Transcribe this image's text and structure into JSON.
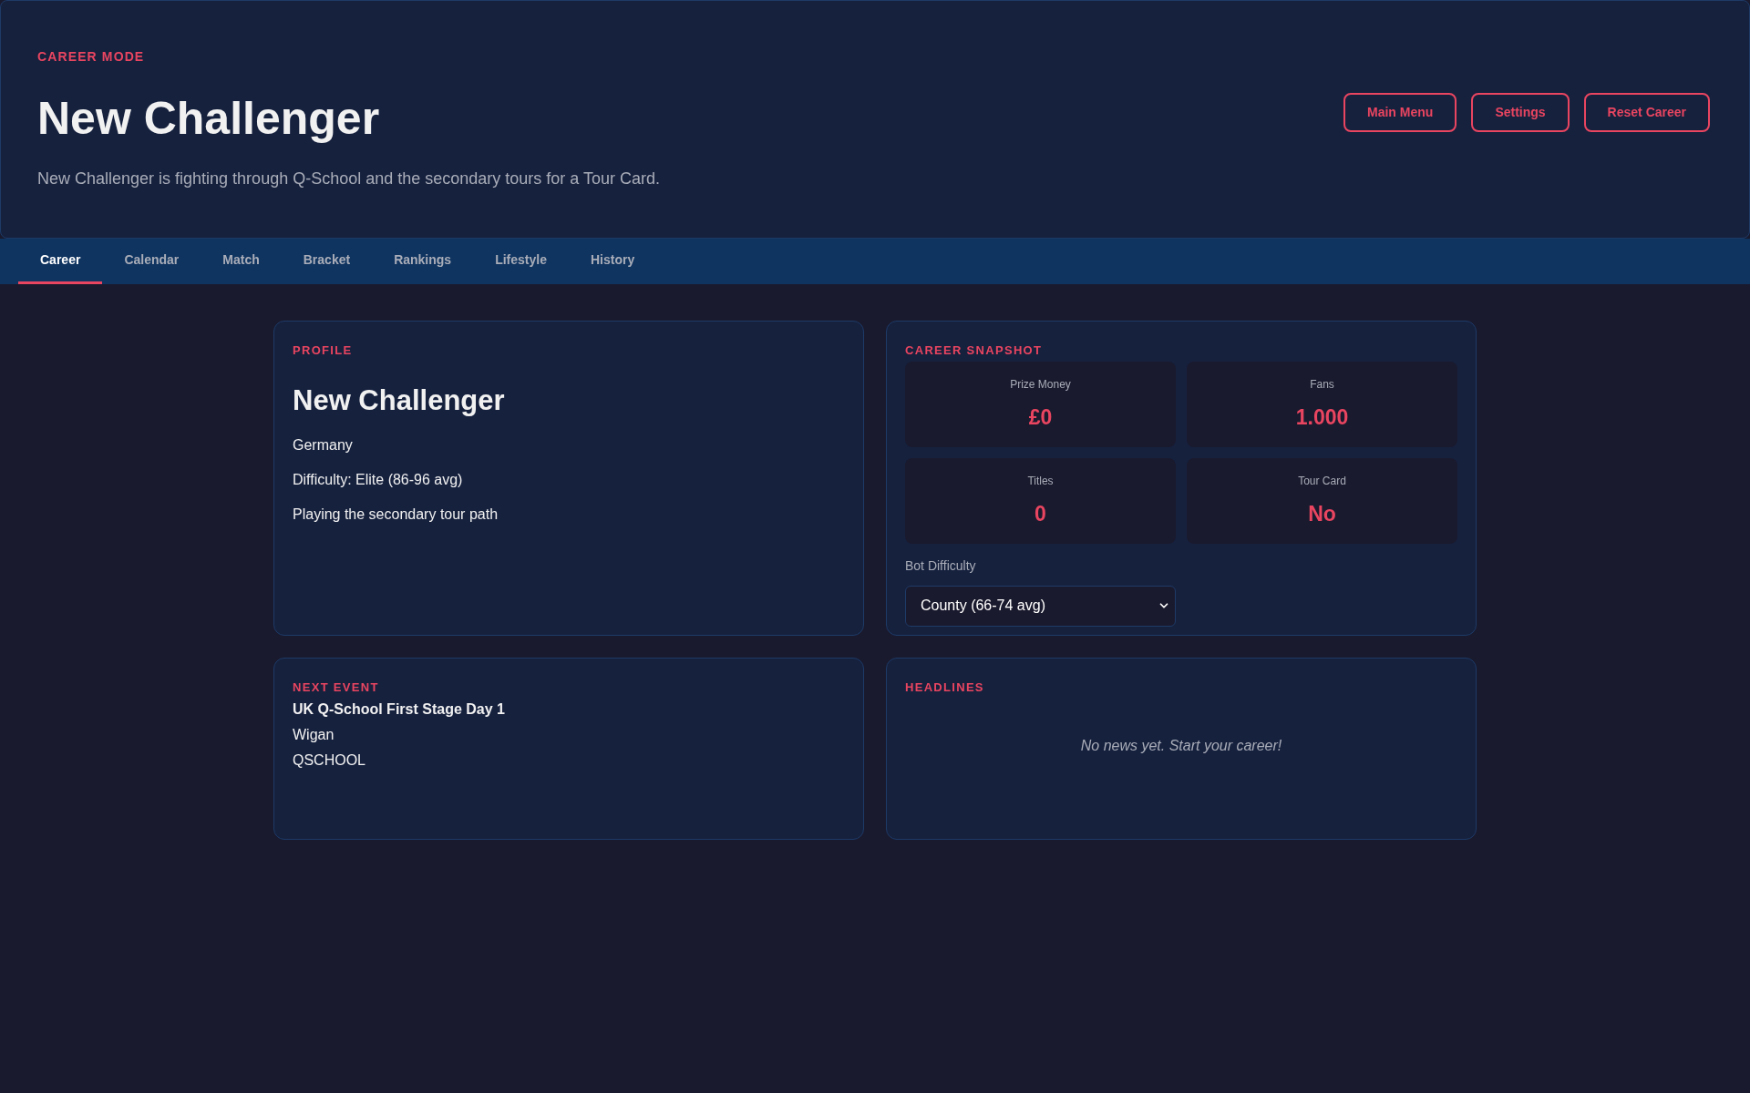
{
  "header": {
    "eyebrow": "CAREER MODE",
    "title": "New Challenger",
    "subtitle": "New Challenger is fighting through Q-School and the secondary tours for a Tour Card.",
    "buttons": [
      "Main Menu",
      "Settings",
      "Reset Career"
    ]
  },
  "tabs": [
    {
      "label": "Career",
      "selected": true
    },
    {
      "label": "Calendar",
      "selected": false
    },
    {
      "label": "Match",
      "selected": false
    },
    {
      "label": "Bracket",
      "selected": false
    },
    {
      "label": "Rankings",
      "selected": false
    },
    {
      "label": "Lifestyle",
      "selected": false
    },
    {
      "label": "History",
      "selected": false
    }
  ],
  "profile": {
    "heading": "PROFILE",
    "name": "New Challenger",
    "lines": [
      "Germany",
      "Difficulty: Elite (86-96 avg)",
      "Playing the secondary tour path"
    ]
  },
  "snapshot": {
    "heading": "CAREER SNAPSHOT",
    "stats": [
      {
        "label": "Prize Money",
        "value": "£0"
      },
      {
        "label": "Fans",
        "value": "1.000"
      },
      {
        "label": "Titles",
        "value": "0"
      },
      {
        "label": "Tour Card",
        "value": "No"
      }
    ],
    "bot_difficulty": {
      "label": "Bot Difficulty",
      "value": "County (66-74 avg)"
    }
  },
  "next_event": {
    "heading": "NEXT EVENT",
    "name": "UK Q-School First Stage Day 1",
    "venue": "Wigan",
    "type": "QSCHOOL"
  },
  "headlines": {
    "heading": "HEADLINES",
    "empty": "No news yet. Start your career!"
  }
}
